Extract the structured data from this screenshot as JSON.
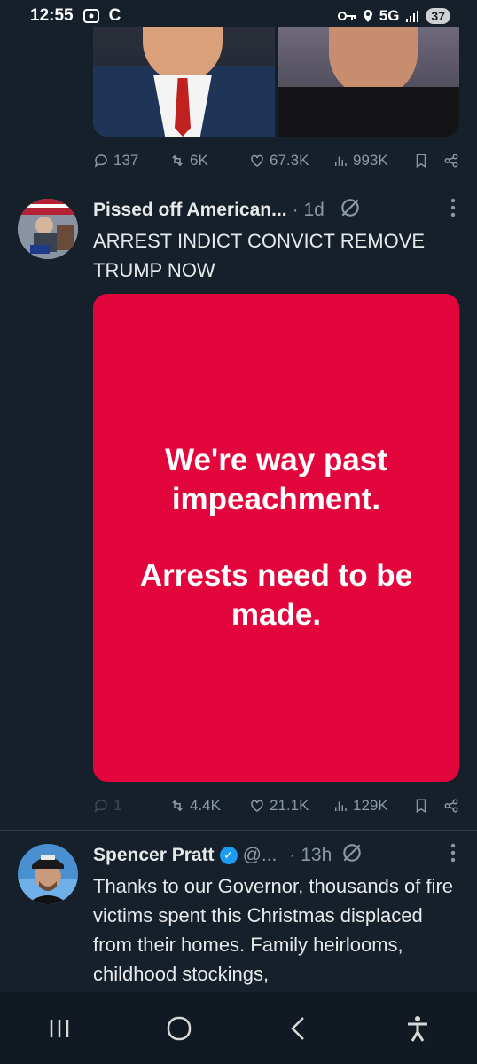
{
  "status_bar": {
    "time": "12:55",
    "network": "5G",
    "battery": "37"
  },
  "prev_tweet": {
    "stats": {
      "replies": "137",
      "reposts": "6K",
      "likes": "67.3K",
      "views": "993K"
    }
  },
  "tweet1": {
    "name": "Pissed off American...",
    "time": "· 1d",
    "text": "ARREST INDICT CONVICT REMOVE TRUMP NOW",
    "image_text": {
      "line1": "We're way past impeachment.",
      "line2": "Arrests need to be made."
    },
    "stats": {
      "replies": "1",
      "reposts": "4.4K",
      "likes": "21.1K",
      "views": "129K"
    }
  },
  "tweet2": {
    "name": "Spencer Pratt",
    "handle": "@...",
    "time": "· 13h",
    "text": "Thanks to our Governor, thousands of fire victims spent this Christmas displaced from their homes. Family heirlooms, childhood stockings,"
  },
  "colors": {
    "background": "#15202b",
    "card_red": "#e2063c",
    "muted": "#8b98a5",
    "verified": "#1d9bf0"
  }
}
